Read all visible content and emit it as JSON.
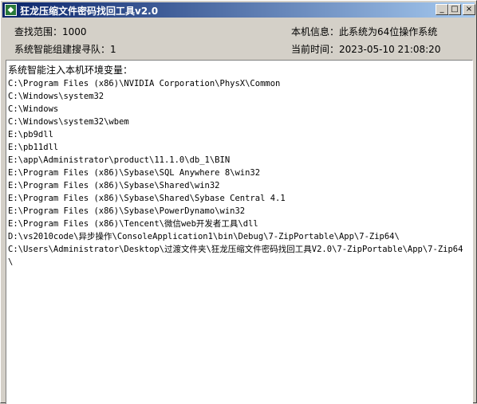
{
  "window": {
    "title": "狂龙压缩文件密码找回工具v2.0",
    "buttons": {
      "minimize": "_",
      "maximize": "□",
      "close": "×"
    }
  },
  "info": {
    "search_range": "查找范围：1000",
    "smart_team": "系统智能组建搜寻队：1",
    "machine_info": "本机信息：此系统为64位操作系统",
    "current_time": "当前时间：2023-05-10 21:08:20"
  },
  "output": {
    "title": "系统智能注入本机环境变量：",
    "lines": [
      "C:\\Program Files (x86)\\NVIDIA Corporation\\PhysX\\Common",
      "C:\\Windows\\system32",
      "C:\\Windows",
      "C:\\Windows\\system32\\wbem",
      "E:\\pb9dll",
      "E:\\pb11dll",
      "E:\\app\\Administrator\\product\\11.1.0\\db_1\\BIN",
      "E:\\Program Files (x86)\\Sybase\\SQL Anywhere 8\\win32",
      "E:\\Program Files (x86)\\Sybase\\Shared\\win32",
      "E:\\Program Files (x86)\\Sybase\\Shared\\Sybase Central 4.1",
      "E:\\Program Files (x86)\\Sybase\\PowerDynamo\\win32",
      "E:\\Program Files (x86)\\Tencent\\微信web开发者工具\\dll",
      "D:\\vs2010code\\异步操作\\ConsoleApplication1\\bin\\Debug\\7-ZipPortable\\App\\7-Zip64\\",
      "C:\\Users\\Administrator\\Desktop\\过渡文件夹\\狂龙压缩文件密码找回工具V2.0\\7-ZipPortable\\App\\7-Zip64",
      "\\"
    ]
  }
}
